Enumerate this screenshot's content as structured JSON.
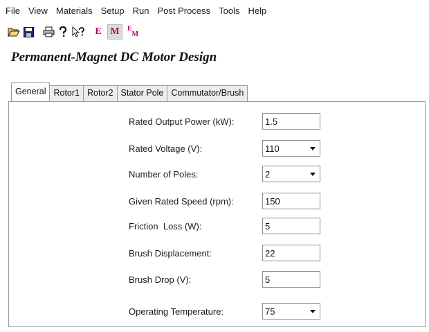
{
  "menu": [
    "File",
    "View",
    "Materials",
    "Setup",
    "Run",
    "Post Process",
    "Tools",
    "Help"
  ],
  "toolbar": {
    "buttons": [
      {
        "name": "open-folder-icon"
      },
      {
        "name": "save-icon"
      },
      {
        "name": "print-icon"
      },
      {
        "name": "help-icon"
      },
      {
        "name": "context-help-icon"
      },
      {
        "name": "e-button",
        "label": "E"
      },
      {
        "name": "m-button",
        "label": "M"
      },
      {
        "name": "em-button",
        "label_top": "E",
        "label_bottom": "M"
      }
    ]
  },
  "heading": "Permanent-Magnet DC Motor Design",
  "tabs": [
    {
      "label": "General",
      "active": true
    },
    {
      "label": "Rotor1",
      "active": false
    },
    {
      "label": "Rotor2",
      "active": false
    },
    {
      "label": "Stator Pole",
      "active": false
    },
    {
      "label": "Commutator/Brush",
      "active": false
    }
  ],
  "fields": [
    {
      "label": "Rated Output Power (kW):",
      "value": "1.5",
      "dropdown": false
    },
    {
      "label": "Rated Voltage (V):",
      "value": "110",
      "dropdown": true
    },
    {
      "label": "Number of Poles:",
      "value": "2",
      "dropdown": true
    },
    {
      "label": "Given Rated Speed (rpm):",
      "value": "150",
      "dropdown": false
    },
    {
      "label": "Friction  Loss (W):",
      "value": "5",
      "dropdown": false
    },
    {
      "label": "Brush Displacement:",
      "value": "22",
      "dropdown": false
    },
    {
      "label": "Brush Drop (V):",
      "value": "5",
      "dropdown": false
    },
    {
      "label": "Operating Temperature:",
      "value": "75",
      "dropdown": true
    }
  ]
}
